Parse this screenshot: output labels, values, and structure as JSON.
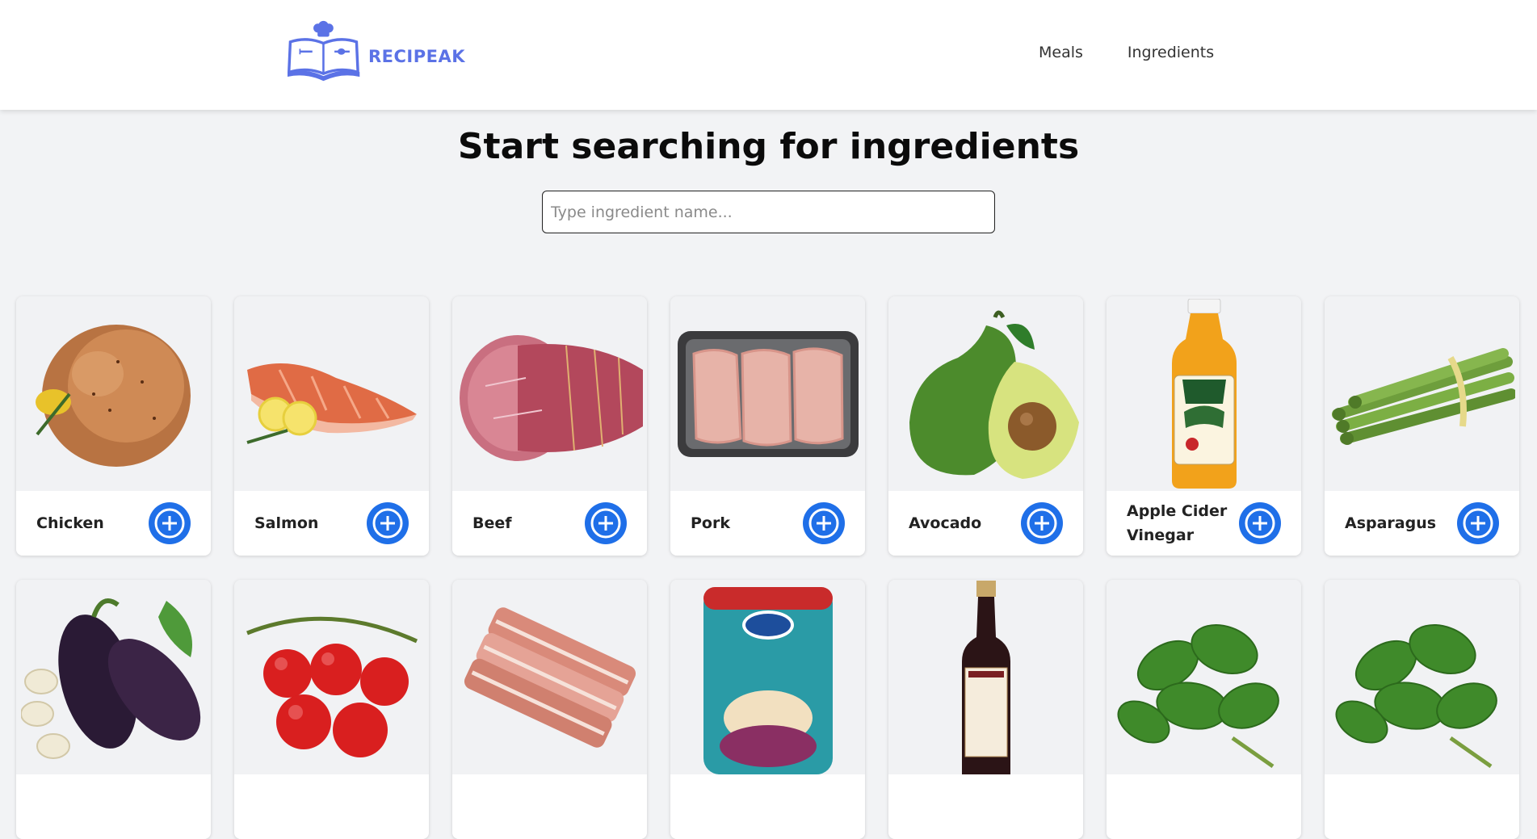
{
  "brand": {
    "name": "RECIPEAK",
    "color": "#5b72e6"
  },
  "nav": {
    "meals": "Meals",
    "ingredients": "Ingredients"
  },
  "hero": {
    "title": "Start searching for ingredients"
  },
  "search": {
    "placeholder": "Type ingredient name...",
    "value": ""
  },
  "accent": "#1f6fe8",
  "ingredients": [
    {
      "name": "Chicken",
      "icon": "roast-chicken-image"
    },
    {
      "name": "Salmon",
      "icon": "salmon-fillet-image"
    },
    {
      "name": "Beef",
      "icon": "beef-roast-image"
    },
    {
      "name": "Pork",
      "icon": "pork-chops-tray-image"
    },
    {
      "name": "Avocado",
      "icon": "avocado-image"
    },
    {
      "name": "Apple Cider Vinegar",
      "icon": "vinegar-bottle-image"
    },
    {
      "name": "Asparagus",
      "icon": "asparagus-bundle-image"
    },
    {
      "name": "",
      "icon": "eggplant-image"
    },
    {
      "name": "",
      "icon": "tomatoes-image"
    },
    {
      "name": "",
      "icon": "bacon-image"
    },
    {
      "name": "",
      "icon": "baking-powder-can-image"
    },
    {
      "name": "",
      "icon": "balsamic-bottle-image"
    },
    {
      "name": "",
      "icon": "basil-image"
    },
    {
      "name": "",
      "icon": "basil-image"
    }
  ]
}
